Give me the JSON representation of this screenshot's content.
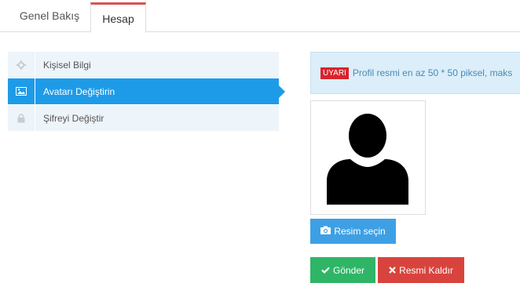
{
  "tabs": [
    {
      "label": "Genel Bakış"
    },
    {
      "label": "Hesap"
    }
  ],
  "menu": [
    {
      "label": "Kişisel Bilgi",
      "icon": "gear-icon"
    },
    {
      "label": "Avatarı Değiştirin",
      "icon": "image-icon"
    },
    {
      "label": "Şifreyi Değiştir",
      "icon": "lock-icon"
    }
  ],
  "alert": {
    "badge": "UYARI",
    "text": "Profil resmi en az 50 * 50 piksel, maks"
  },
  "buttons": {
    "choose": "Resim seçin",
    "send": "Gönder",
    "remove": "Resmi Kaldır"
  },
  "colors": {
    "accent": "#1e9be8",
    "danger": "#d8443d",
    "success": "#2fb566",
    "tab_active_border": "#d9534f"
  }
}
